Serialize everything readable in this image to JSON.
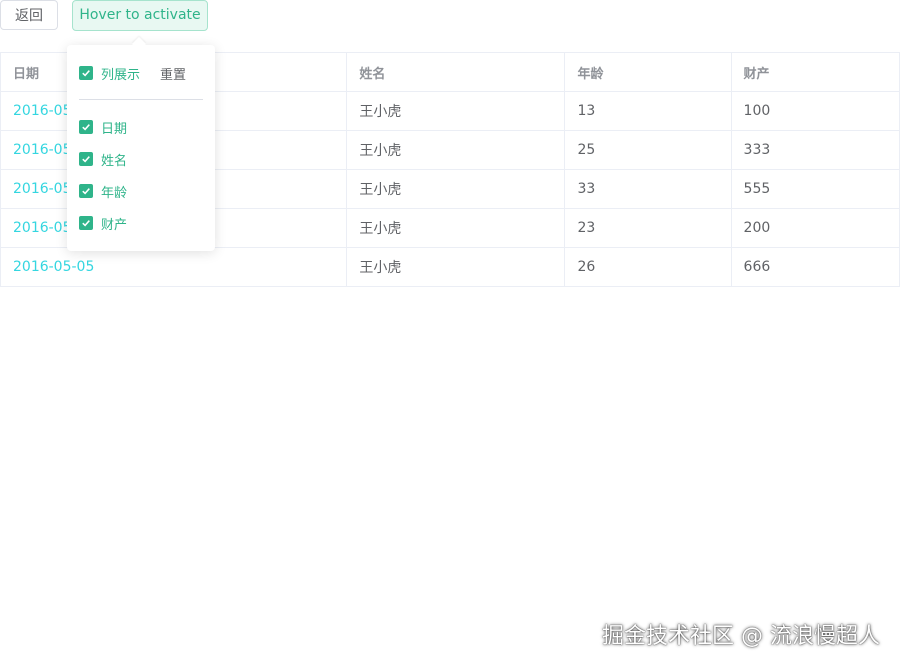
{
  "toolbar": {
    "back_label": "返回",
    "hover_label": "Hover to activate"
  },
  "table": {
    "columns": [
      "日期",
      "姓名",
      "年龄",
      "财产"
    ],
    "rows": [
      [
        "2016-05",
        "王小虎",
        "13",
        "100"
      ],
      [
        "2016-05",
        "王小虎",
        "25",
        "333"
      ],
      [
        "2016-05",
        "王小虎",
        "33",
        "555"
      ],
      [
        "2016-05",
        "王小虎",
        "23",
        "200"
      ],
      [
        "2016-05-05",
        "王小虎",
        "26",
        "666"
      ]
    ]
  },
  "popover": {
    "show_all_label": "列展示",
    "reset_label": "重置",
    "columns": [
      "日期",
      "姓名",
      "年龄",
      "财产"
    ],
    "checked_icon": "checkmark-icon"
  },
  "watermark": "掘金技术社区 @ 流浪慢超人",
  "colors": {
    "accent": "#2fb48a",
    "date_link": "#34d6e0"
  }
}
